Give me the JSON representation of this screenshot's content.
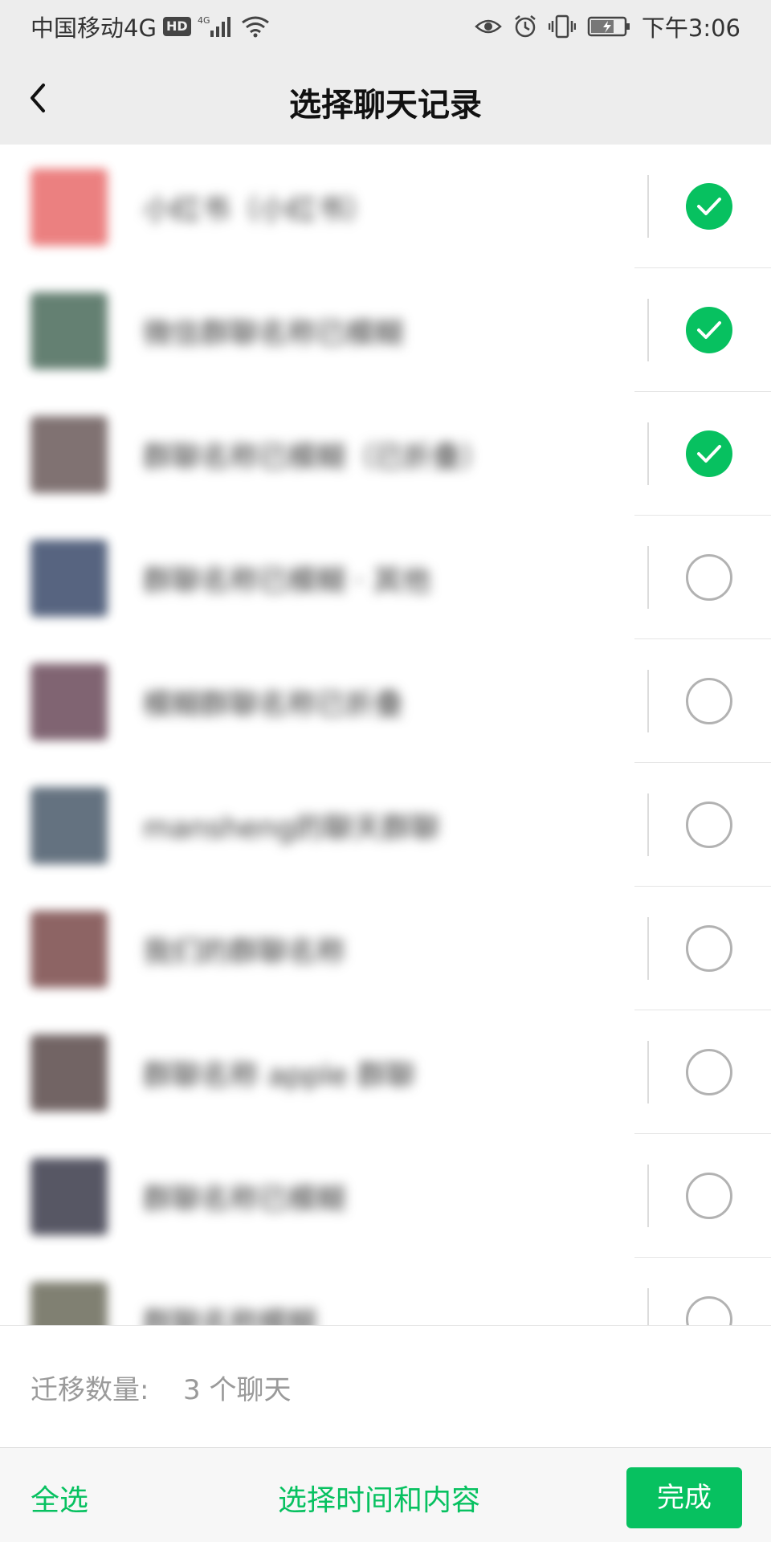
{
  "status_bar": {
    "carrier": "中国移动4G",
    "hd_badge": "HD",
    "network": "4G",
    "time": "下午3:06",
    "icons": [
      "signal-icon",
      "wifi-icon",
      "eye-icon",
      "alarm-icon",
      "vibrate-icon",
      "battery-icon"
    ]
  },
  "nav": {
    "title": "选择聊天记录",
    "back_icon": "back-arrow-icon"
  },
  "chats": [
    {
      "name": "小红书（小红书）",
      "checked": true,
      "avatar_color": "#e86a6a"
    },
    {
      "name": "微信群聊名称已模糊",
      "checked": true,
      "avatar_color": "#4a6a5a"
    },
    {
      "name": "群聊名称已模糊（已折叠）",
      "checked": true,
      "avatar_color": "#6a5a5a"
    },
    {
      "name": "群聊名称已模糊 · 其他",
      "checked": false,
      "avatar_color": "#3a4a6a"
    },
    {
      "name": "模糊群聊名称已折叠",
      "checked": false,
      "avatar_color": "#6a4a5a"
    },
    {
      "name": "mansheng的聊天群聊",
      "checked": false,
      "avatar_color": "#4a5a6a"
    },
    {
      "name": "我们的群聊名称",
      "checked": false,
      "avatar_color": "#7a4a4a"
    },
    {
      "name": "群聊名称 apple 群聊",
      "checked": false,
      "avatar_color": "#5a4a4a"
    },
    {
      "name": "群聊名称已模糊",
      "checked": false,
      "avatar_color": "#3a3a4a"
    },
    {
      "name": "群聊名称模糊",
      "checked": false,
      "avatar_color": "#6a6a5a"
    }
  ],
  "migration": {
    "label": "迁移数量:",
    "value": "3 个聊天"
  },
  "bottom_bar": {
    "select_all": "全选",
    "select_time": "选择时间和内容",
    "done": "完成"
  },
  "colors": {
    "accent": "#07c160",
    "header_bg": "#ededed",
    "unchecked_border": "#b2b2b2"
  }
}
